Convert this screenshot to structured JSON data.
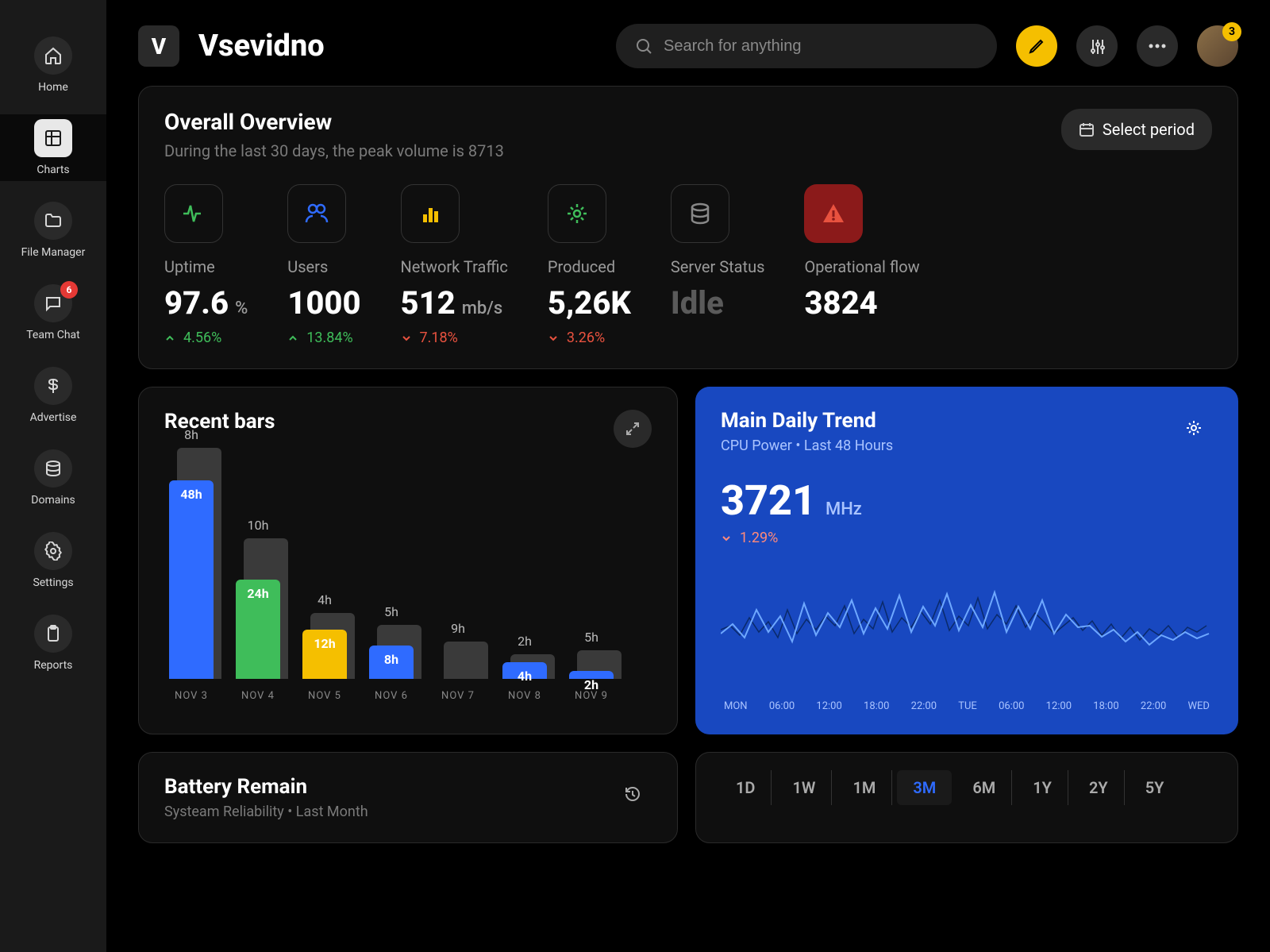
{
  "brand": {
    "letter": "V",
    "name": "Vsevidno"
  },
  "search": {
    "placeholder": "Search for anything"
  },
  "avatar": {
    "badge": "3"
  },
  "sidebar": {
    "items": [
      {
        "label": "Home"
      },
      {
        "label": "Charts"
      },
      {
        "label": "File Manager"
      },
      {
        "label": "Team Chat",
        "badge": "6"
      },
      {
        "label": "Advertise"
      },
      {
        "label": "Domains"
      },
      {
        "label": "Settings"
      },
      {
        "label": "Reports"
      }
    ]
  },
  "overview": {
    "title": "Overall Overview",
    "subtitle": "During the last 30 days, the peak volume is 8713",
    "period_btn": "Select period",
    "kpis": [
      {
        "label": "Uptime",
        "value": "97.6",
        "unit": "%",
        "delta": "4.56%",
        "dir": "up"
      },
      {
        "label": "Users",
        "value": "1000",
        "unit": "",
        "delta": "13.84%",
        "dir": "up"
      },
      {
        "label": "Network Traffic",
        "value": "512",
        "unit": "mb/s",
        "delta": "7.18%",
        "dir": "down"
      },
      {
        "label": "Produced",
        "value": "5,26K",
        "unit": "",
        "delta": "3.26%",
        "dir": "down"
      },
      {
        "label": "Server Status",
        "value": "Idle",
        "unit": "",
        "delta": "",
        "dir": ""
      },
      {
        "label": "Operational flow",
        "value": "3824",
        "unit": "",
        "delta": "",
        "dir": ""
      }
    ]
  },
  "recent_bars": {
    "title": "Recent bars"
  },
  "chart_data": {
    "type": "bar",
    "title": "Recent bars",
    "categories": [
      "NOV 3",
      "NOV 4",
      "NOV 5",
      "NOV 6",
      "NOV 7",
      "NOV 8",
      "NOV 9"
    ],
    "series": [
      {
        "name": "front_hours",
        "values": [
          48,
          24,
          12,
          8,
          0,
          4,
          2
        ],
        "labels": [
          "48h",
          "24h",
          "12h",
          "8h",
          "",
          "4h",
          "2h"
        ],
        "colors": [
          "#2f6bff",
          "#3fbd5a",
          "#f5bf00",
          "#2f6bff",
          "",
          "#2f6bff",
          "#2f6bff"
        ]
      },
      {
        "name": "back_hours",
        "values": [
          8,
          10,
          4,
          5,
          9,
          2,
          5
        ],
        "labels": [
          "8h",
          "10h",
          "4h",
          "5h",
          "9h",
          "2h",
          "5h"
        ]
      }
    ],
    "ylabel": "hours"
  },
  "main_trend": {
    "title": "Main Daily Trend",
    "subtitle": "CPU Power • Last 48 Hours",
    "value": "3721",
    "unit": "MHz",
    "delta": "1.29%",
    "axis": [
      "MON",
      "06:00",
      "12:00",
      "18:00",
      "22:00",
      "TUE",
      "06:00",
      "12:00",
      "18:00",
      "22:00",
      "WED"
    ]
  },
  "battery": {
    "title": "Battery Remain",
    "subtitle": "Systeam Reliability • Last Month"
  },
  "range": {
    "tabs": [
      "1D",
      "1W",
      "1M",
      "3M",
      "6M",
      "1Y",
      "2Y",
      "5Y"
    ],
    "active": "3M"
  }
}
